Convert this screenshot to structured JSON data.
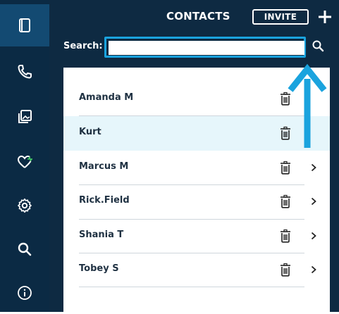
{
  "header": {
    "title": "CONTACTS",
    "invite_label": "INVITE"
  },
  "search": {
    "label": "Search:",
    "value": "",
    "placeholder": ""
  },
  "contacts": [
    {
      "name": "Amanda M",
      "selected": false,
      "has_chevron": false
    },
    {
      "name": "Kurt",
      "selected": true,
      "has_chevron": false
    },
    {
      "name": "Marcus M",
      "selected": false,
      "has_chevron": true
    },
    {
      "name": "Rick.Field",
      "selected": false,
      "has_chevron": true
    },
    {
      "name": "Shania T",
      "selected": false,
      "has_chevron": true
    },
    {
      "name": "Tobey S",
      "selected": false,
      "has_chevron": true
    }
  ],
  "sidebar": {
    "items": [
      {
        "icon": "device-icon",
        "active": true
      },
      {
        "icon": "phone-icon",
        "active": false
      },
      {
        "icon": "gallery-icon",
        "active": false
      },
      {
        "icon": "heart-pulse-icon",
        "active": false
      },
      {
        "icon": "gear-icon",
        "active": false
      },
      {
        "icon": "search-icon",
        "active": false
      },
      {
        "icon": "info-icon",
        "active": false
      }
    ]
  },
  "colors": {
    "sidebar_bg": "#0b2a44",
    "panel_bg": "#0e2a42",
    "accent": "#1aa3de",
    "selected_row": "#e6f6fb"
  }
}
